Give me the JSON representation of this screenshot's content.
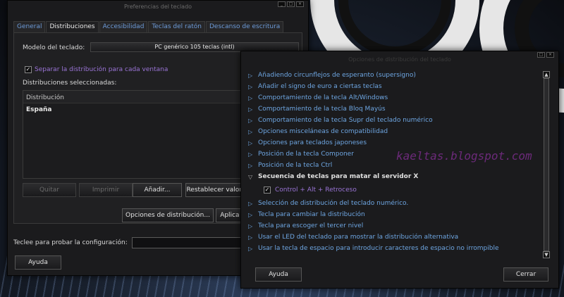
{
  "main_window": {
    "title": "Preferencias del teclado",
    "tabs": [
      "General",
      "Distribuciones",
      "Accesibilidad",
      "Teclas del ratón",
      "Descanso de escritura"
    ],
    "model_label": "Modelo del teclado:",
    "model_value": "PC genérico 105 teclas (intl)",
    "separate_checkbox_label": "Separar la distribución para cada ventana",
    "selected_label": "Distribuciones seleccionadas:",
    "list_header": "Distribución",
    "list_rows": [
      "España"
    ],
    "buttons": {
      "remove": "Quitar",
      "print": "Imprimir",
      "add": "Añadir...",
      "reset": "Restablecer valores p",
      "options": "Opciones de distribución...",
      "apply": "Aplica a to",
      "help": "Ayuda"
    },
    "test_label": "Teclee para probar la configuración:"
  },
  "options_window": {
    "title": "Opciones de distribución del teclado",
    "items": [
      "Añadiendo circunflejos de esperanto (supersigno)",
      "Añadir el signo de euro a ciertas teclas",
      "Comportamiento de la tecla Alt/Windows",
      "Comportamiento de la tecla Bloq Mayús",
      "Comportamiento de la tecla Supr del teclado numérico",
      "Opciones misceláneas de compatibilidad",
      "Opciones para teclados japoneses",
      "Posición de la tecla Componer",
      "Posición de la tecla Ctrl"
    ],
    "expanded_item": "Secuencia de teclas para matar al servidor X",
    "expanded_child": "Control + Alt + Retroceso",
    "items_after": [
      "Selección de distribución del teclado numérico.",
      "Tecla para cambiar la distribución",
      "Tecla para escoger el tercer nivel",
      "Usar el LED del teclado para mostrar la distribución alternativa",
      "Usar la tecla de espacio para introducir caracteres de espacio no irrompible"
    ],
    "help_button": "Ayuda",
    "close_button": "Cerrar"
  },
  "watermark": "kaeltas.blogspot.com",
  "colors": {
    "link": "#6ea6e2",
    "purple": "#9a74d6",
    "window_bg": "#1b1b1d"
  }
}
